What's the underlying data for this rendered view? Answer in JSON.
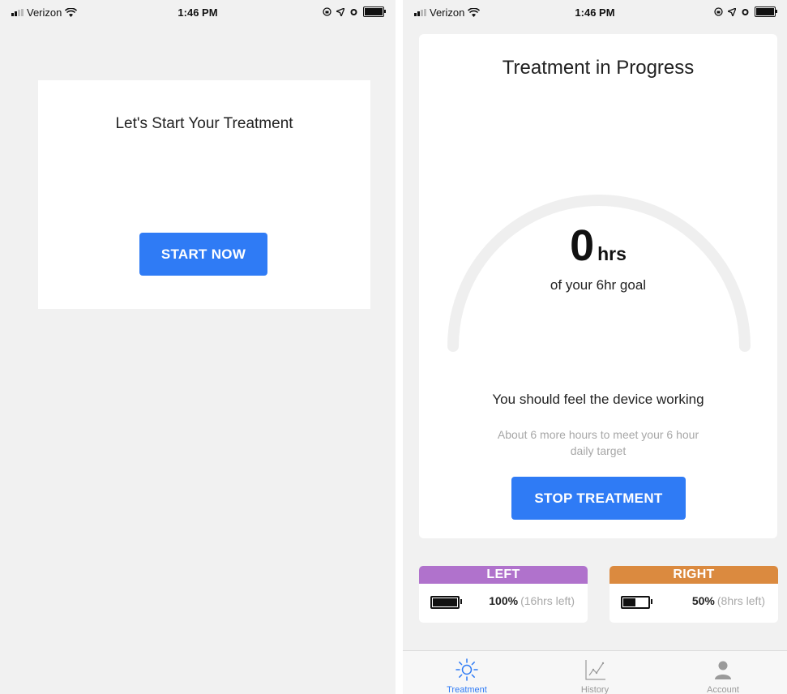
{
  "status_bar": {
    "carrier": "Verizon",
    "time": "1:46 PM"
  },
  "start_screen": {
    "title": "Let's Start Your Treatment",
    "start_button": "START NOW"
  },
  "treatment_screen": {
    "title": "Treatment in Progress",
    "hours_value": "0",
    "hours_unit": "hrs",
    "goal_text": "of your 6hr goal",
    "progress_fraction": 0,
    "status_message": "You should feel the device working",
    "remaining_text": "About 6 more hours to meet your 6 hour daily target",
    "stop_button": "STOP TREATMENT",
    "devices": [
      {
        "label": "LEFT",
        "color": "#b072cc",
        "percent_text": "100%",
        "time_left_text": "(16hrs left)",
        "battery_fraction": 1.0
      },
      {
        "label": "RIGHT",
        "color": "#db8a3f",
        "percent_text": "50%",
        "time_left_text": "(8hrs left)",
        "battery_fraction": 0.5
      }
    ]
  },
  "tab_bar": {
    "tabs": [
      {
        "label": "Treatment",
        "icon": "sun-icon",
        "active": true
      },
      {
        "label": "History",
        "icon": "chart-line-icon",
        "active": false
      },
      {
        "label": "Account",
        "icon": "person-icon",
        "active": false
      }
    ]
  },
  "colors": {
    "accent": "#2f7bf5",
    "background": "#f1f1f1",
    "gauge_track": "#efefef"
  }
}
